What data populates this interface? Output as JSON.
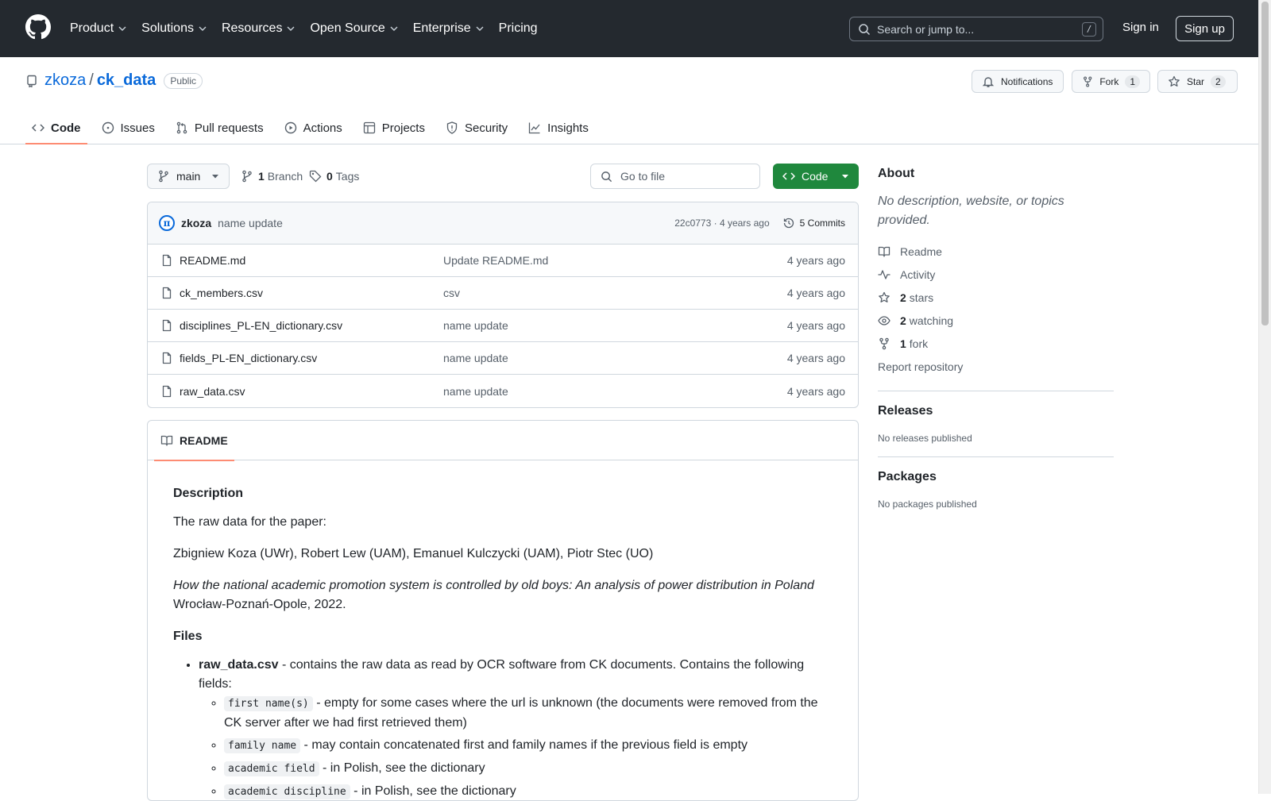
{
  "topnav": {
    "items": [
      {
        "label": "Product",
        "has_caret": true
      },
      {
        "label": "Solutions",
        "has_caret": true
      },
      {
        "label": "Resources",
        "has_caret": true
      },
      {
        "label": "Open Source",
        "has_caret": true
      },
      {
        "label": "Enterprise",
        "has_caret": true
      },
      {
        "label": "Pricing",
        "has_caret": false
      }
    ],
    "search_placeholder": "Search or jump to...",
    "search_shortcut": "/",
    "signin_label": "Sign in",
    "signup_label": "Sign up"
  },
  "repo": {
    "owner": "zkoza",
    "separator": "/",
    "name": "ck_data",
    "visibility": "Public",
    "notifications_label": "Notifications",
    "fork_label": "Fork",
    "fork_count": "1",
    "star_label": "Star",
    "star_count": "2"
  },
  "tabs": [
    {
      "label": "Code",
      "icon": "code-icon",
      "active": true
    },
    {
      "label": "Issues",
      "icon": "issue-icon",
      "active": false
    },
    {
      "label": "Pull requests",
      "icon": "pull-request-icon",
      "active": false
    },
    {
      "label": "Actions",
      "icon": "play-icon",
      "active": false
    },
    {
      "label": "Projects",
      "icon": "table-icon",
      "active": false
    },
    {
      "label": "Security",
      "icon": "shield-icon",
      "active": false
    },
    {
      "label": "Insights",
      "icon": "graph-icon",
      "active": false
    }
  ],
  "toolbar": {
    "branch": "main",
    "branch_count": "1",
    "branch_label": "Branch",
    "tag_count": "0",
    "tag_label": "Tags",
    "goto_placeholder": "Go to file",
    "code_label": "Code"
  },
  "commit": {
    "avatar_glyph": "π",
    "author": "zkoza",
    "message": "name update",
    "meta": "22c0773 · 4 years ago",
    "commits_label": "5 Commits"
  },
  "files": [
    {
      "name": "README.md",
      "message": "Update README.md",
      "age": "4 years ago"
    },
    {
      "name": "ck_members.csv",
      "message": "csv",
      "age": "4 years ago"
    },
    {
      "name": "disciplines_PL-EN_dictionary.csv",
      "message": "name update",
      "age": "4 years ago"
    },
    {
      "name": "fields_PL-EN_dictionary.csv",
      "message": "name update",
      "age": "4 years ago"
    },
    {
      "name": "raw_data.csv",
      "message": "name update",
      "age": "4 years ago"
    }
  ],
  "readme": {
    "tab_label": "README",
    "h_description": "Description",
    "p_intro": "The raw data for the paper:",
    "p_authors": "Zbigniew Koza (UWr), Robert Lew (UAM), Emanuel Kulczycki (UAM), Piotr Stec (UO)",
    "paper_title": "How the national academic promotion system is controlled by old boys: An analysis of power distribution in Poland",
    "paper_place": "Wrocław-Poznań-Opole, 2022.",
    "h_files": "Files",
    "file1_name": "raw_data.csv",
    "file1_desc": " - contains the raw data as read by OCR software from CK documents. Contains the following fields:",
    "fields": [
      {
        "code": "first name(s)",
        "desc": " - empty for some cases where the url is unknown (the documents were removed from the CK server after we had first retrieved them)"
      },
      {
        "code": "family name",
        "desc": " - may contain concatenated first and family names if the previous field is empty"
      },
      {
        "code": "academic field",
        "desc": " - in Polish, see the dictionary"
      },
      {
        "code": "academic discipline",
        "desc": " - in Polish, see the dictionary"
      }
    ]
  },
  "sidebar": {
    "about_title": "About",
    "about_desc": "No description, website, or topics provided.",
    "readme_label": "Readme",
    "activity_label": "Activity",
    "stars_count": "2",
    "stars_label": "stars",
    "watching_count": "2",
    "watching_label": "watching",
    "fork_count": "1",
    "fork_label": "fork",
    "report_label": "Report repository",
    "releases_title": "Releases",
    "releases_empty": "No releases published",
    "packages_title": "Packages",
    "packages_empty": "No packages published"
  },
  "colors": {
    "header_bg": "#24292f",
    "link": "#0969da",
    "code_button": "#1f883d",
    "active_tab_underline": "#fd8c73"
  }
}
